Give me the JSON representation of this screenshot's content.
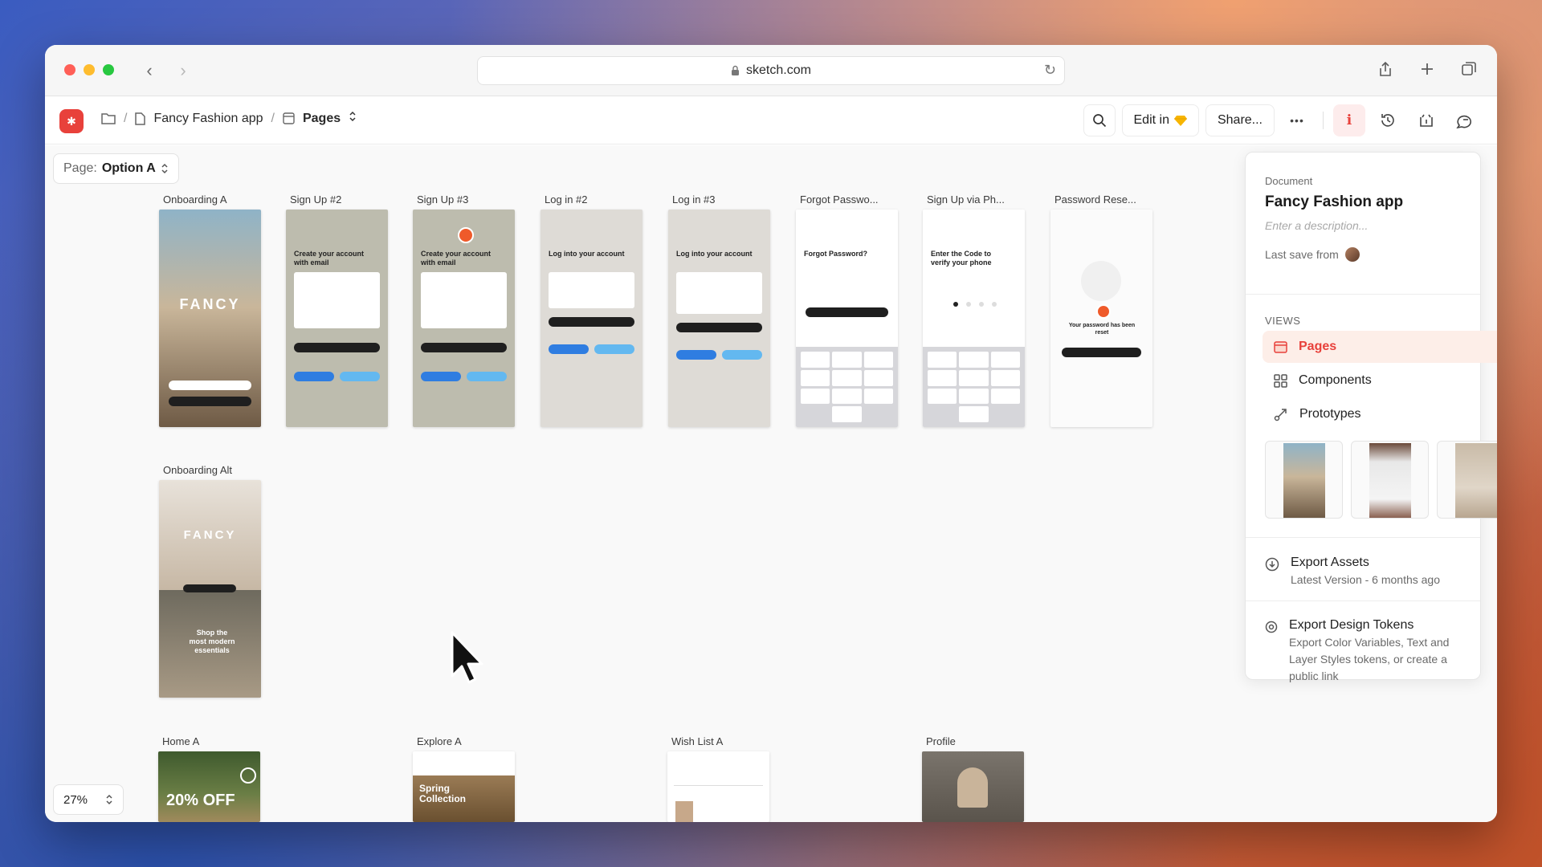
{
  "browser": {
    "url": "sketch.com",
    "back_icon": "chevron-left-icon",
    "forward_icon": "chevron-right-icon"
  },
  "toolbar": {
    "project": "Fancy Fashion app",
    "section": "Pages",
    "edit_label": "Edit in",
    "share_label": "Share...",
    "more_label": "•••"
  },
  "canvas": {
    "page_prefix": "Page:",
    "page_name": "Option A",
    "zoom": "27%"
  },
  "artboards": {
    "row1": [
      {
        "label": "Onboarding A"
      },
      {
        "label": "Sign Up #2",
        "title": "Create your account with email"
      },
      {
        "label": "Sign Up #3",
        "title": "Create your account with email"
      },
      {
        "label": "Log in #2",
        "title": "Log into your account"
      },
      {
        "label": "Log in #3",
        "title": "Log into your account"
      },
      {
        "label": "Forgot Passwo...",
        "title": "Forgot Password?"
      },
      {
        "label": "Sign Up via Ph...",
        "title": "Enter the Code to verify your phone"
      },
      {
        "label": "Password Rese...",
        "title": "Your password has been reset"
      }
    ],
    "onboarding_alt": {
      "label": "Onboarding Alt",
      "brand": "FANCY",
      "tagline": "Shop the most modern essentials"
    },
    "onboarding_a_brand": "FANCY",
    "row3": [
      {
        "label": "Home A",
        "promo": "20% OFF"
      },
      {
        "label": "Explore A",
        "promo": "Spring Collection"
      },
      {
        "label": "Wish List A"
      },
      {
        "label": "Profile"
      }
    ]
  },
  "inspector": {
    "doc_label": "Document",
    "doc_title": "Fancy Fashion app",
    "doc_desc_placeholder": "Enter a description...",
    "last_save": "Last save from",
    "views_heading": "VIEWS",
    "views": [
      {
        "label": "Pages",
        "icon": "pages-icon",
        "selected": true
      },
      {
        "label": "Components",
        "icon": "components-icon",
        "selected": false
      },
      {
        "label": "Prototypes",
        "icon": "prototypes-icon",
        "selected": false
      }
    ],
    "export_assets": {
      "title": "Export Assets",
      "subtitle": "Latest Version - 6 months ago"
    },
    "export_tokens": {
      "title": "Export Design Tokens",
      "subtitle": "Export Color Variables, Text and Layer Styles tokens, or create a public link"
    }
  },
  "colors": {
    "accent": "#e8413b",
    "selected_bg": "#fdeee8"
  }
}
